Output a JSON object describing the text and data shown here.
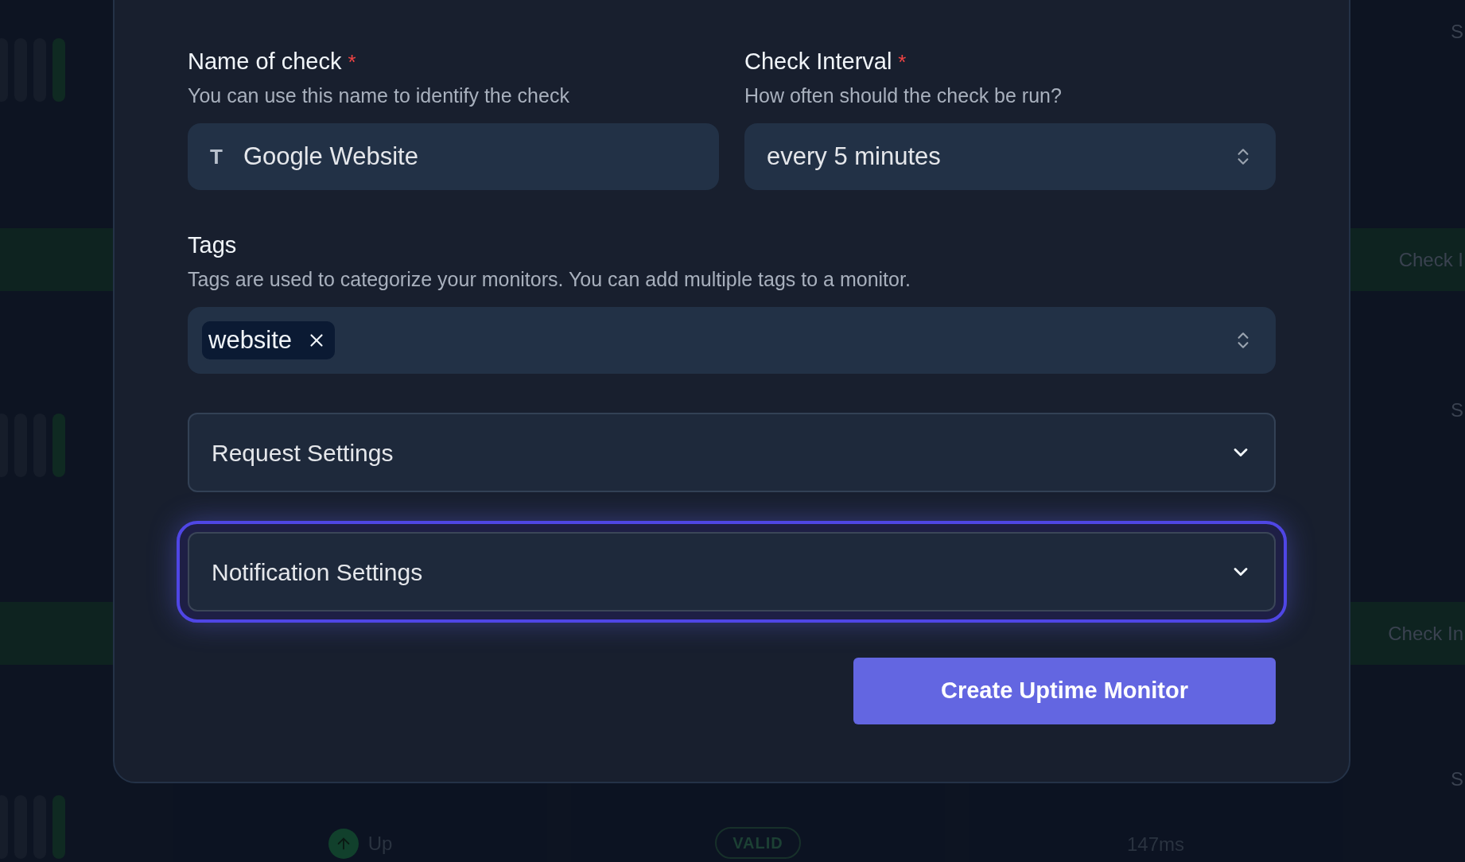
{
  "background": {
    "right_labels": [
      "S",
      "Check I",
      "S",
      "Check In",
      "S"
    ],
    "cards": [
      {
        "kind": "status",
        "text": "Up"
      },
      {
        "kind": "badge",
        "text": "VALID"
      },
      {
        "kind": "text",
        "text": "147ms"
      }
    ]
  },
  "form": {
    "fields": [
      {
        "kind": "text",
        "type_icon": "T",
        "label": "Name of check",
        "required_mark": "*",
        "hint": "You can use this name to identify the check",
        "value": "Google Website"
      },
      {
        "kind": "select",
        "label": "Check Interval",
        "required_mark": "*",
        "hint": "How often should the check be run?",
        "value": "every 5 minutes"
      }
    ],
    "tags": {
      "label": "Tags",
      "hint": "Tags are used to categorize your monitors. You can add multiple tags to a monitor.",
      "items": [
        "website"
      ]
    },
    "sections": [
      {
        "label": "Request Settings",
        "focused": false
      },
      {
        "label": "Notification Settings",
        "focused": true
      }
    ],
    "submit": "Create Uptime Monitor"
  }
}
